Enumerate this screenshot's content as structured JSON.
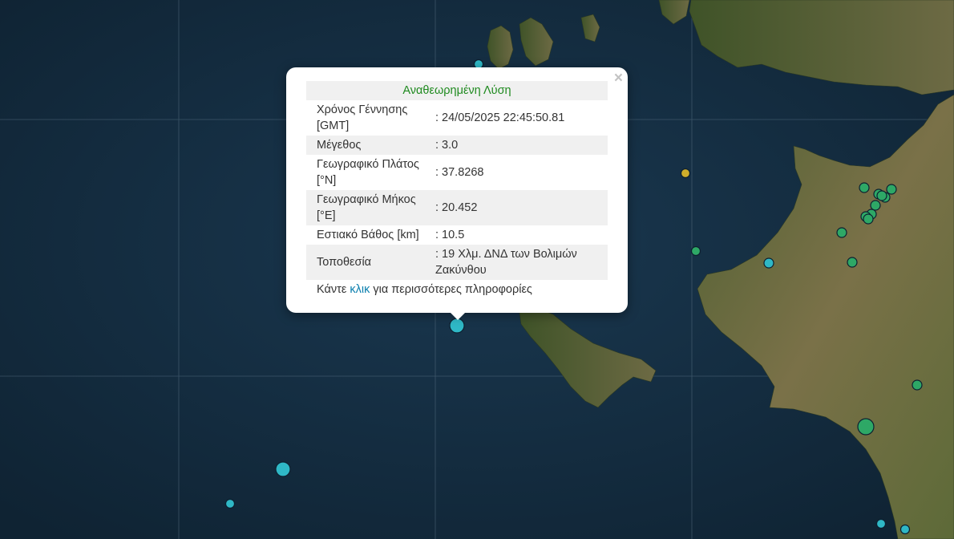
{
  "popup": {
    "title": "Αναθεωρημένη Λύση",
    "close_symbol": "×",
    "rows": [
      {
        "label": "Χρόνος Γέννησης [GMT]",
        "value": ": 24/05/2025 22:45:50.81"
      },
      {
        "label": "Μέγεθος",
        "value": ": 3.0"
      },
      {
        "label": "Γεωγραφικό Πλάτος [°N]",
        "value": ": 37.8268"
      },
      {
        "label": "Γεωγραφικό Μήκος [°E]",
        "value": ": 20.452"
      },
      {
        "label": "Εστιακό Βάθος [km]",
        "value": ": 10.5"
      },
      {
        "label": "Τοποθεσία",
        "value": ": 19 Χλμ. ΔΝΔ των Βολιμών Ζακύνθου"
      }
    ],
    "more_prefix": "Κάντε",
    "more_link": "κλικ",
    "more_suffix": "για περισσότερες πληροφορίες"
  },
  "colors": {
    "sea": "#142c3f",
    "land": "#5e6a3c",
    "marker_cyan": "#2fb8c6",
    "marker_green": "#2ea866",
    "marker_yellow": "#cfae2b",
    "title_green": "#1f8a1f",
    "link": "#0b7fae"
  }
}
